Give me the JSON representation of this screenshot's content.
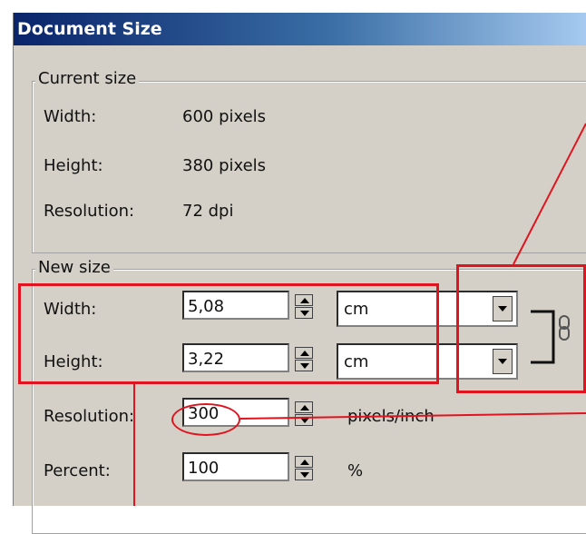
{
  "window": {
    "title": "Document Size"
  },
  "current_size": {
    "legend": "Current size",
    "width_label": "Width:",
    "width_value": "600 pixels",
    "height_label": "Height:",
    "height_value": "380 pixels",
    "resolution_label": "Resolution:",
    "resolution_value": "72 dpi"
  },
  "new_size": {
    "legend": "New size",
    "width_label": "Width:",
    "width_value": "5,08",
    "width_unit": "cm",
    "height_label": "Height:",
    "height_value": "3,22",
    "height_unit": "cm",
    "resolution_label": "Resolution:",
    "resolution_value": "300",
    "resolution_unit": "pixels/inch",
    "percent_label": "Percent:",
    "percent_value": "100",
    "percent_unit": "%"
  },
  "colors": {
    "annotation": "#e0141e",
    "titlebar": "#0a246a",
    "dialog": "#d4d0c8"
  },
  "icons": {
    "spinner": "updown-arrows-icon",
    "dropdown": "chevron-down-icon",
    "link": "chain-link-icon"
  }
}
